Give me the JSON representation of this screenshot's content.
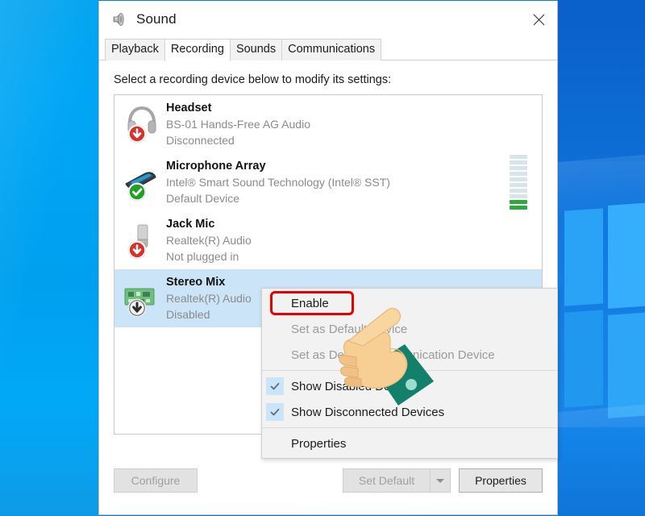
{
  "window": {
    "title": "Sound",
    "icon": "speaker-icon",
    "close_label": "×"
  },
  "tabs": [
    {
      "label": "Playback",
      "active": false
    },
    {
      "label": "Recording",
      "active": true
    },
    {
      "label": "Sounds",
      "active": false
    },
    {
      "label": "Communications",
      "active": false
    }
  ],
  "instruction": "Select a recording device below to modify its settings:",
  "devices": [
    {
      "name": "Headset",
      "description": "BS-01 Hands-Free AG Audio",
      "status": "Disconnected",
      "icon": "headset-icon",
      "badge": "red-down-arrow-badge",
      "selected": false,
      "meter": null
    },
    {
      "name": "Microphone Array",
      "description": "Intel® Smart Sound Technology (Intel® SST)",
      "status": "Default Device",
      "icon": "microphone-array-icon",
      "badge": "green-check-badge",
      "selected": false,
      "meter": {
        "segments": 10,
        "active": 2
      }
    },
    {
      "name": "Jack Mic",
      "description": "Realtek(R) Audio",
      "status": "Not plugged in",
      "icon": "jack-mic-icon",
      "badge": "red-down-arrow-badge",
      "selected": false,
      "meter": null
    },
    {
      "name": "Stereo Mix",
      "description": "Realtek(R) Audio",
      "status": "Disabled",
      "icon": "circuit-board-icon",
      "badge": "gray-down-arrow-badge",
      "selected": true,
      "meter": null
    }
  ],
  "context_menu": [
    {
      "label": "Enable",
      "disabled": false,
      "checked": false,
      "highlighted": true
    },
    {
      "label": "Set as Default Device",
      "disabled": true,
      "checked": false,
      "highlighted": false
    },
    {
      "label": "Set as Default Communication Device",
      "disabled": true,
      "checked": false,
      "highlighted": false
    },
    {
      "label": "Show Disabled Devices",
      "disabled": false,
      "checked": true,
      "highlighted": false
    },
    {
      "label": "Show Disconnected Devices",
      "disabled": false,
      "checked": true,
      "highlighted": false
    },
    {
      "label": "Properties",
      "disabled": false,
      "checked": false,
      "highlighted": false
    }
  ],
  "buttons": {
    "configure": "Configure",
    "set_default": "Set Default",
    "properties": "Properties"
  },
  "colors": {
    "selection": "#CCE4F7",
    "highlight_ring": "#E60000",
    "meter_active": "#2EAA3C",
    "default_badge": "#21A121",
    "disconnected_badge": "#D43A2F",
    "desktop_blue": "#00A6F5",
    "hand_skin": "#F5C98E",
    "hand_sleeve": "#12806A"
  }
}
